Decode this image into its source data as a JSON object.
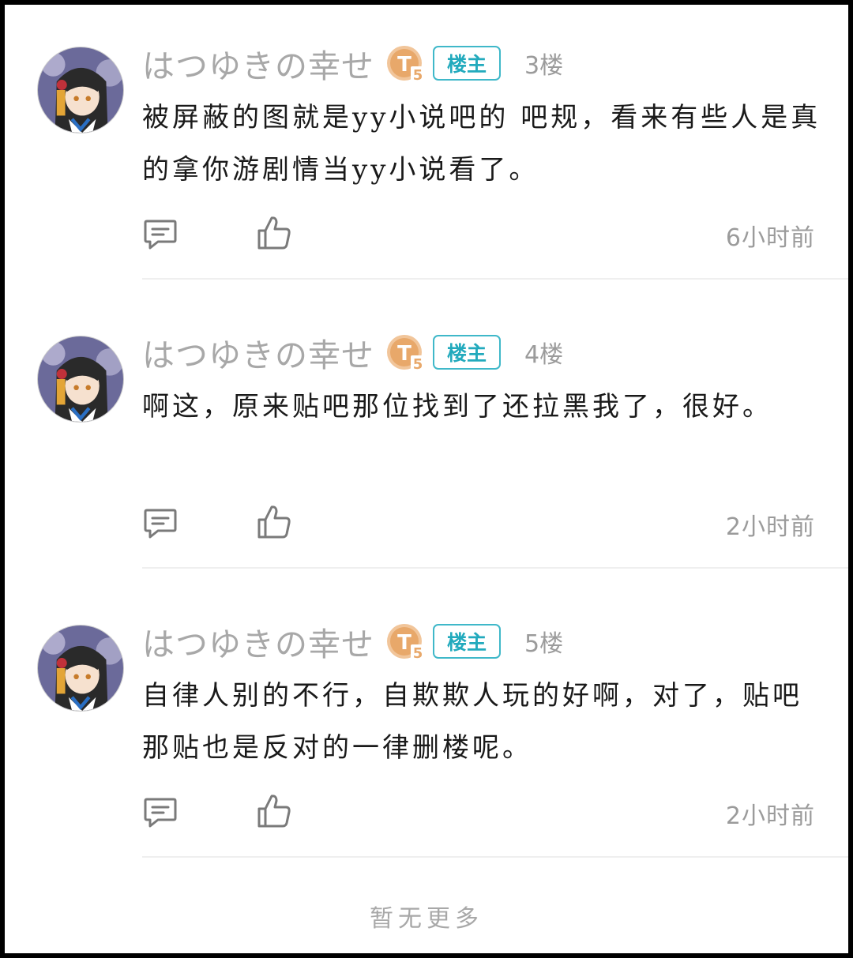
{
  "posts": [
    {
      "username": "はつゆきの幸せ",
      "level": "5",
      "op_badge": "楼主",
      "floor": "3楼",
      "content": "被屏蔽的图就是yy小说吧的 吧规，看来有些人是真的拿你游剧情当yy小说看了。",
      "time": "6小时前"
    },
    {
      "username": "はつゆきの幸せ",
      "level": "5",
      "op_badge": "楼主",
      "floor": "4楼",
      "content": "啊这，原来贴吧那位找到了还拉黑我了，很好。",
      "time": "2小时前"
    },
    {
      "username": "はつゆきの幸せ",
      "level": "5",
      "op_badge": "楼主",
      "floor": "5楼",
      "content": "自律人别的不行，自欺欺人玩的好啊，对了，贴吧那贴也是反对的一律删楼呢。",
      "time": "2小时前"
    }
  ],
  "footer": "暂无更多",
  "icons": {
    "reply": "comment-icon",
    "like": "thumbs-up-icon",
    "level": "level-badge-icon"
  },
  "colors": {
    "op_badge": "#22aabd",
    "level_badge": "#e8a86a",
    "muted_text": "#a8a8a8",
    "body_text": "#1a1a1a"
  }
}
